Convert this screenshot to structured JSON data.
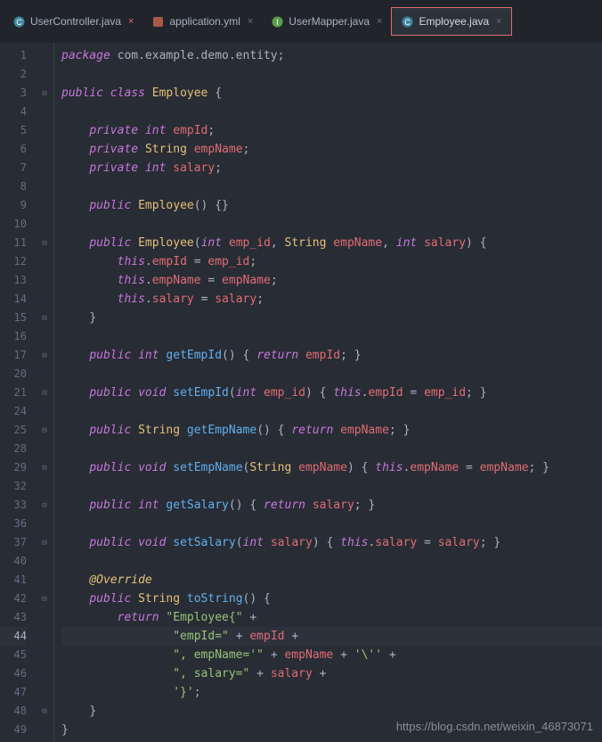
{
  "tabs": [
    {
      "label": "UserController.java",
      "active": false,
      "close": "red"
    },
    {
      "label": "application.yml",
      "active": false,
      "close": "gray"
    },
    {
      "label": "UserMapper.java",
      "active": false,
      "close": "gray"
    },
    {
      "label": "Employee.java",
      "active": true,
      "close": "gray"
    }
  ],
  "lines": [
    "1",
    "2",
    "3",
    "4",
    "5",
    "6",
    "7",
    "8",
    "9",
    "10",
    "11",
    "12",
    "13",
    "14",
    "15",
    "16",
    "17",
    "20",
    "21",
    "24",
    "25",
    "28",
    "29",
    "32",
    "33",
    "36",
    "37",
    "40",
    "41",
    "42",
    "43",
    "44",
    "45",
    "46",
    "47",
    "48",
    "49"
  ],
  "active_line": "44",
  "code": {
    "package_kw": "package",
    "package_ns": "com.example.demo.entity",
    "public": "public",
    "class_kw": "class",
    "class_name": "Employee",
    "private": "private",
    "int": "int",
    "string": "String",
    "void": "void",
    "return": "return",
    "this": "this",
    "override": "@Override",
    "f_empId": "empId",
    "f_empName": "empName",
    "f_salary": "salary",
    "ctor": "Employee",
    "p_emp_id": "emp_id",
    "p_empName": "empName",
    "p_salary": "salary",
    "m_getEmpId": "getEmpId",
    "m_setEmpId": "setEmpId",
    "m_getEmpName": "getEmpName",
    "m_setEmpName": "setEmpName",
    "m_getSalary": "getSalary",
    "m_setSalary": "setSalary",
    "m_toString": "toString",
    "s_emp": "\"Employee{\"",
    "s_empId": "\"empId=\"",
    "s_empName": "\", empName='\"",
    "s_salary": "\", salary=\"",
    "s_close": "'}'",
    "s_tick": "'\\''",
    "plus": " + "
  },
  "watermark": "https://blog.csdn.net/weixin_46873071"
}
